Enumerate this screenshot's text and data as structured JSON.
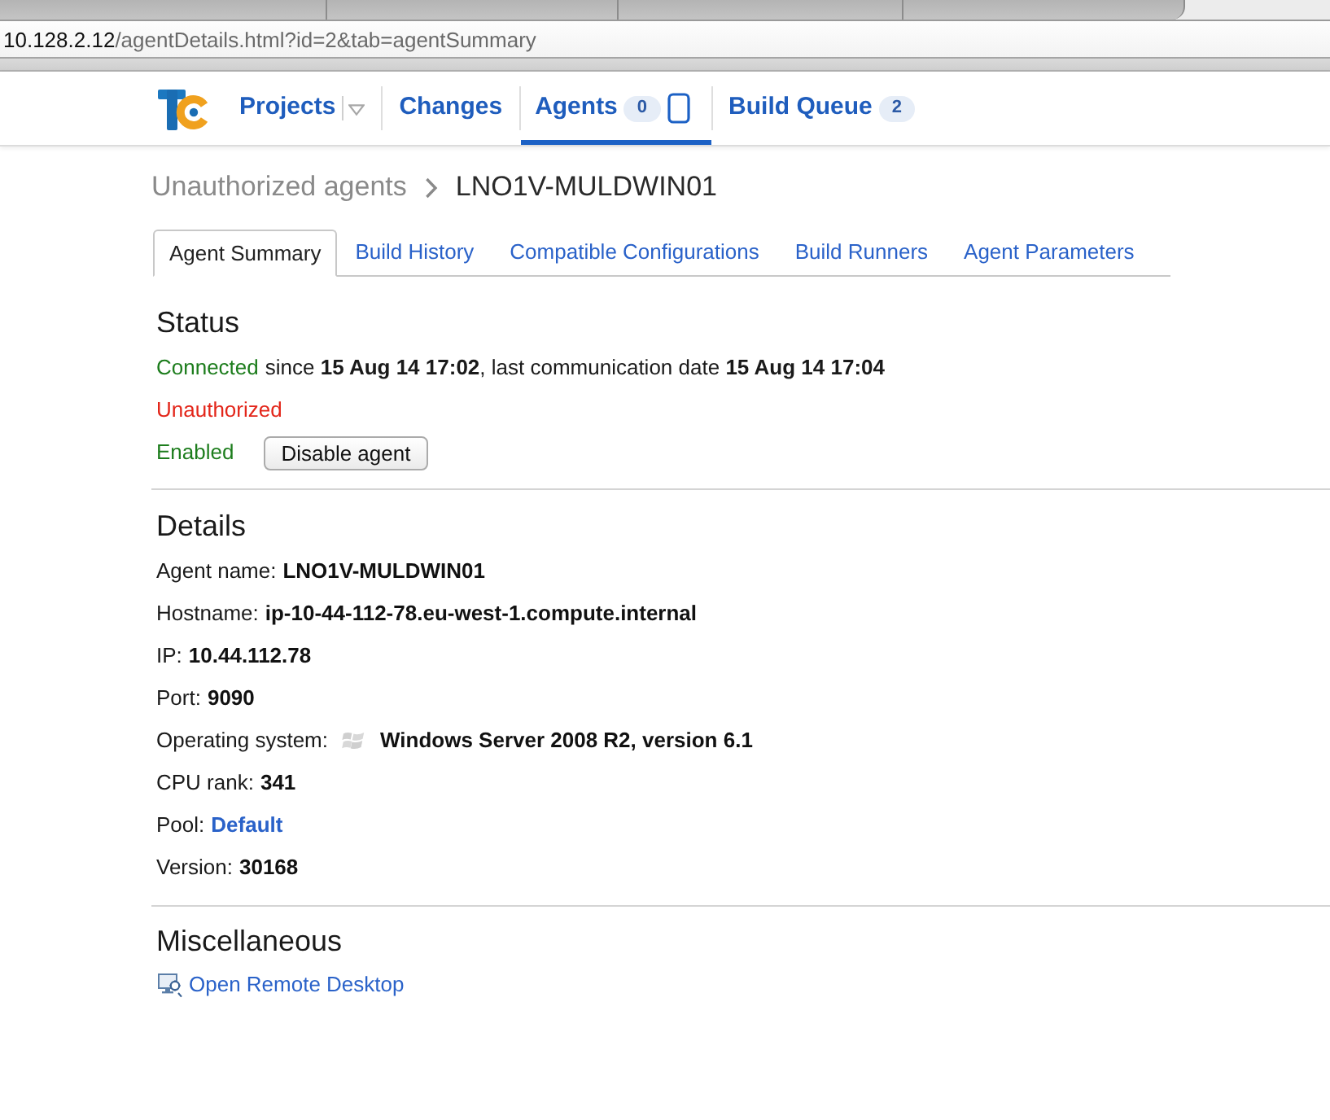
{
  "address_bar": {
    "host": "10.128.2.12",
    "path": "/agentDetails.html?id=2&tab=agentSummary"
  },
  "nav": [
    {
      "kind": "dropdown",
      "label": "Projects",
      "selected": false
    },
    {
      "kind": "link",
      "label": "Changes",
      "selected": false
    },
    {
      "kind": "agents",
      "label": "Agents",
      "badge": "0",
      "selected": true
    },
    {
      "kind": "link",
      "label": "Build Queue",
      "badge": "2",
      "selected": false
    }
  ],
  "breadcrumb": {
    "parent": "Unauthorized agents",
    "current": "LNO1V-MULDWIN01"
  },
  "tabs": [
    {
      "label": "Agent Summary",
      "selected": true
    },
    {
      "label": "Build History",
      "selected": false
    },
    {
      "label": "Compatible Configurations",
      "selected": false
    },
    {
      "label": "Build Runners",
      "selected": false
    },
    {
      "label": "Agent Parameters",
      "selected": false
    }
  ],
  "status": {
    "title": "Status",
    "lines": [
      {
        "label": "Connected",
        "color": "#1d7d1d",
        "text": "since **15 Aug 14 17:02**, last communication date **15 Aug 14 17:04**"
      },
      {
        "label": "Unauthorized",
        "color": "#e3261a"
      },
      {
        "label": "Enabled",
        "color": "#1d7d1d",
        "button": "Disable agent"
      }
    ]
  },
  "details": {
    "title": "Details",
    "rows": [
      {
        "kind": "text",
        "label": "Agent name:",
        "value": "LNO1V-MULDWIN01"
      },
      {
        "kind": "text",
        "label": "Hostname:",
        "value": "ip-10-44-112-78.eu-west-1.compute.internal"
      },
      {
        "kind": "text",
        "label": "IP:",
        "value": "10.44.112.78"
      },
      {
        "kind": "text",
        "label": "Port:",
        "value": "9090"
      },
      {
        "kind": "os",
        "label": "Operating system:",
        "value": "Windows Server 2008 R2, version 6.1"
      },
      {
        "kind": "text",
        "label": "CPU rank:",
        "value": "341"
      },
      {
        "kind": "link",
        "label": "Pool:",
        "value": "Default"
      },
      {
        "kind": "text",
        "label": "Version:",
        "value": "30168"
      }
    ]
  },
  "misc": {
    "title": "Miscellaneous",
    "links": [
      {
        "label": "Open Remote Desktop"
      }
    ]
  }
}
